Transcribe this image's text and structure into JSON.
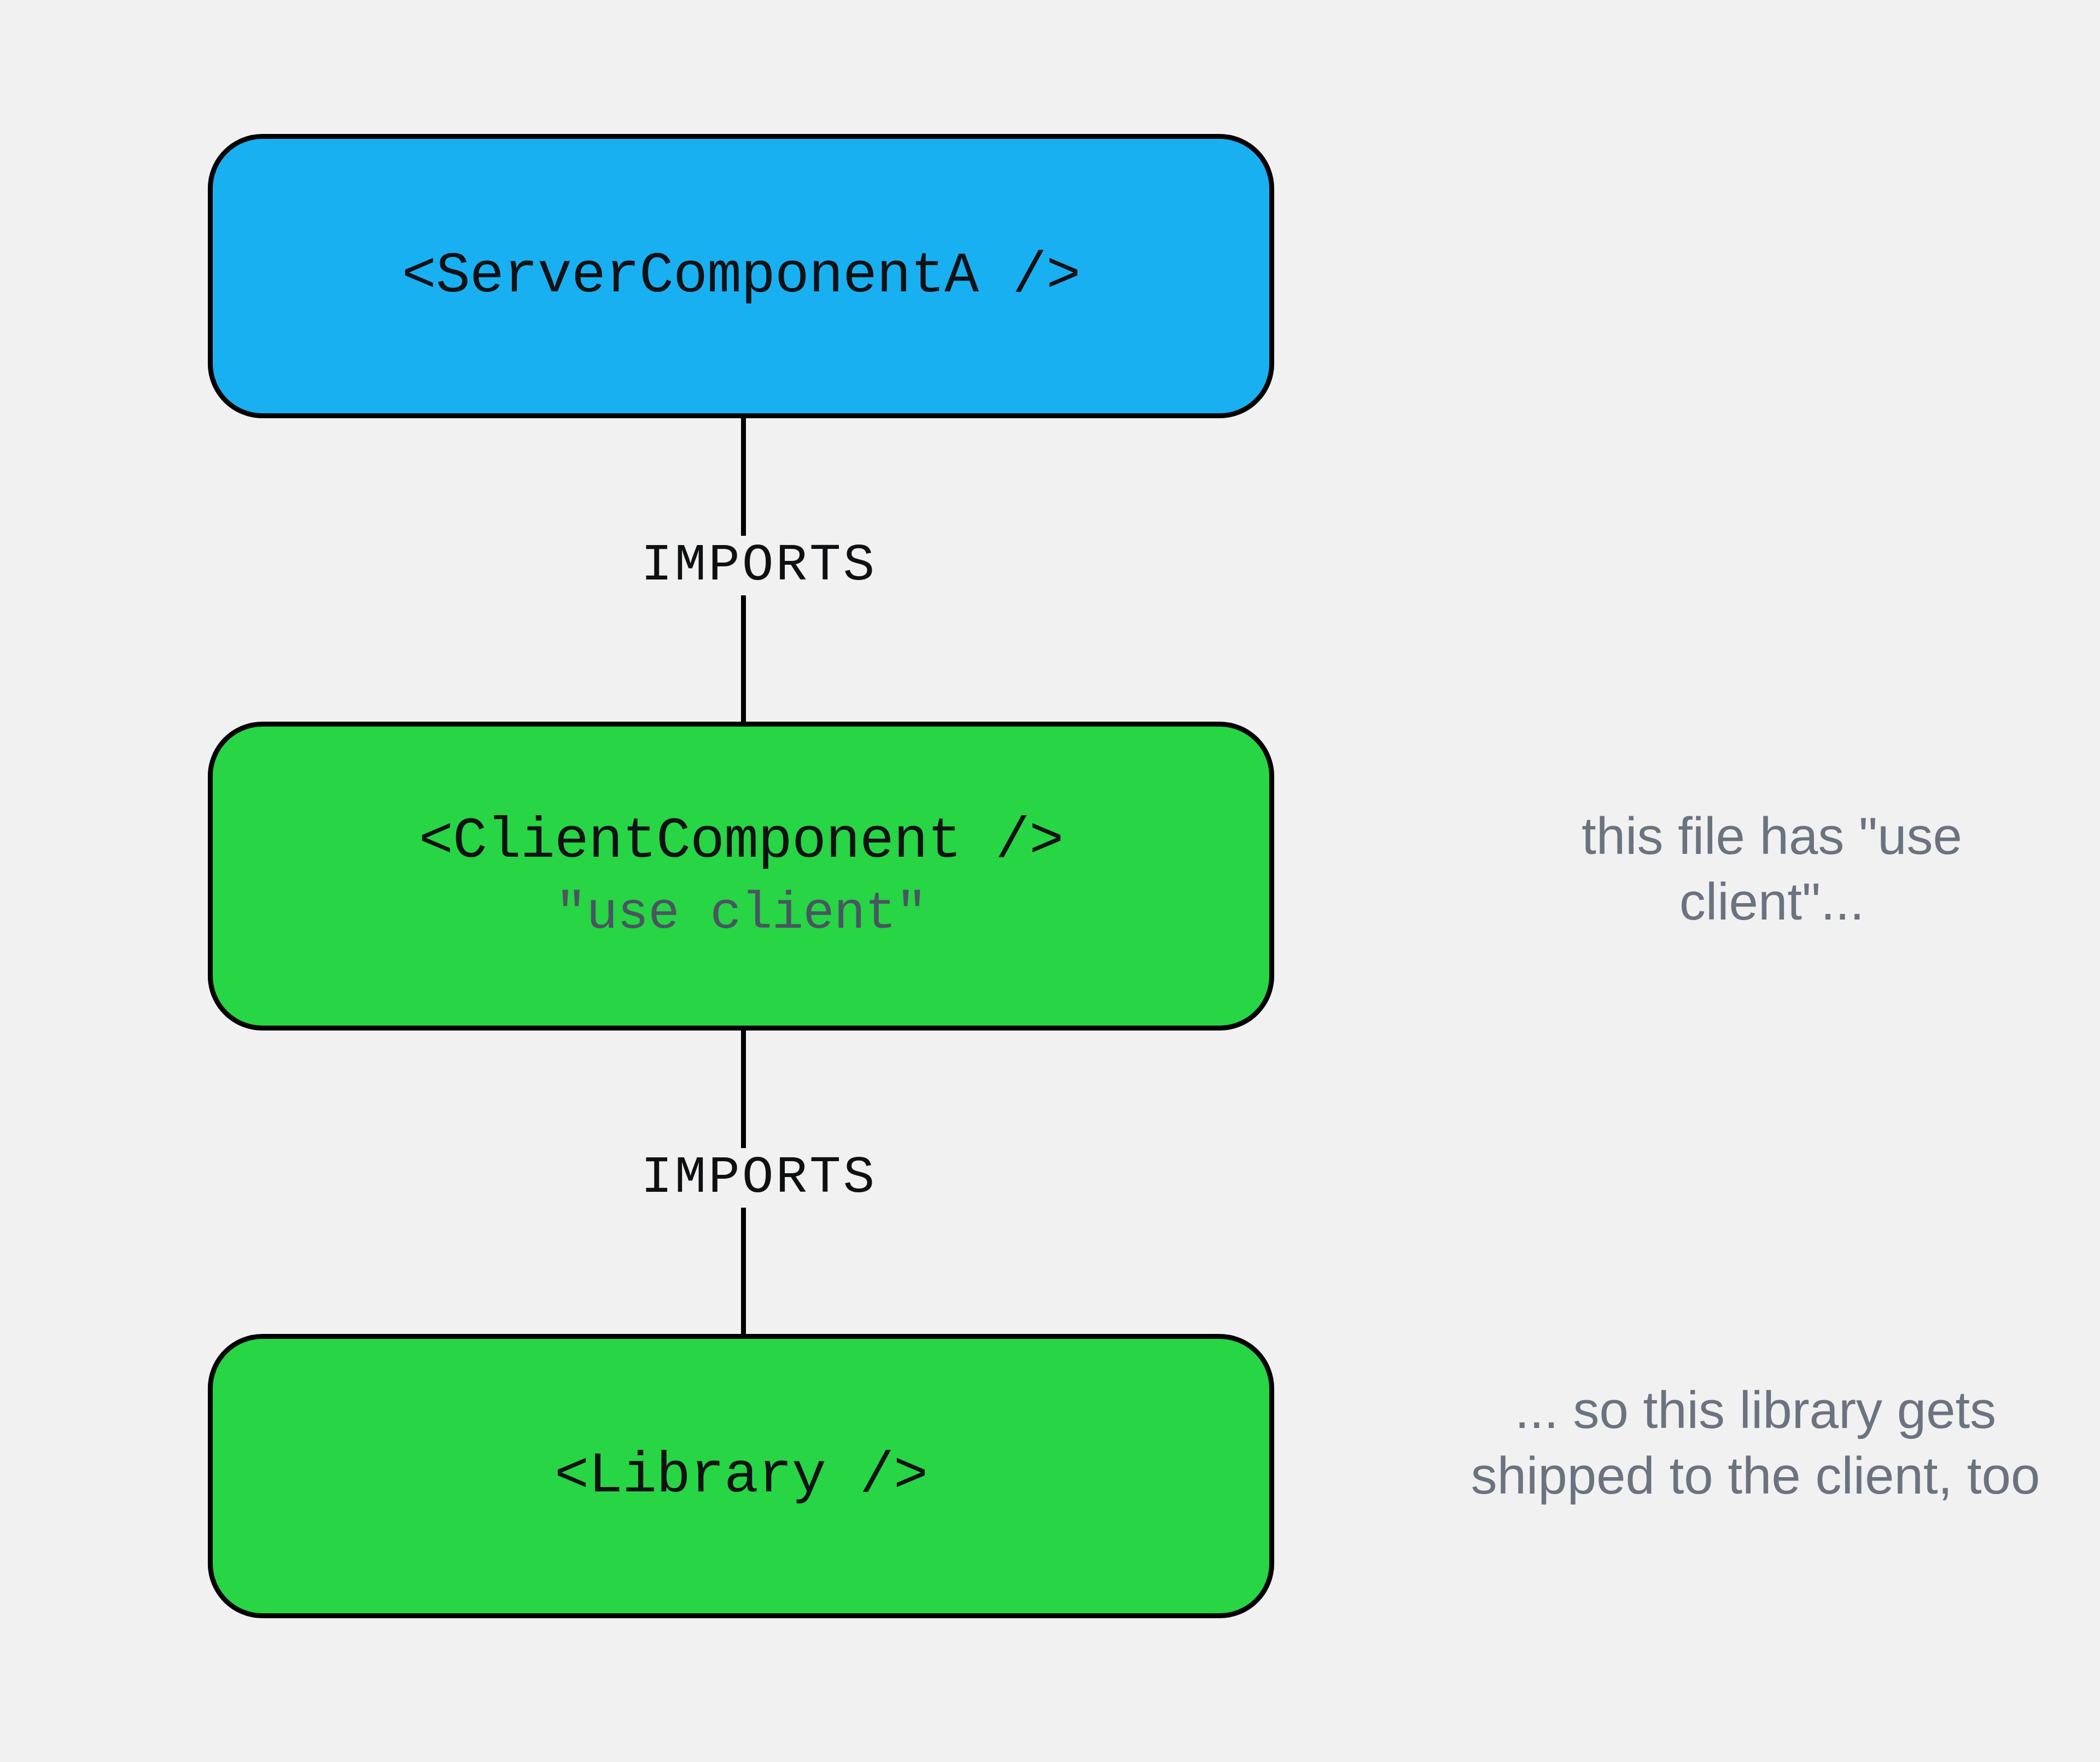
{
  "nodes": {
    "server": {
      "title": "<ServerComponentA />"
    },
    "client": {
      "title": "<ClientComponent />",
      "sub": "\"use client\""
    },
    "library": {
      "title": "<Library />"
    }
  },
  "edges": {
    "imports1": "IMPORTS",
    "imports2": "IMPORTS"
  },
  "annotations": {
    "note1": "this file has \"use client\"...",
    "note2": "... so this library gets shipped to the client, too"
  },
  "colors": {
    "bg": "#f1f1f1",
    "blue": "#19b0f2",
    "green": "#27d545",
    "stroke": "#000000",
    "muted": "#6b7380"
  }
}
